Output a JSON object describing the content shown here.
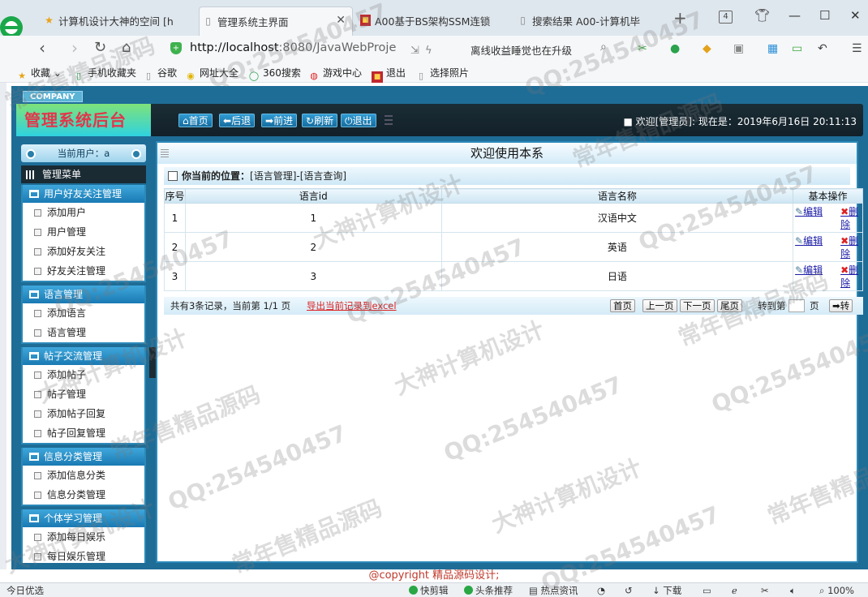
{
  "browser": {
    "tabs": [
      {
        "label": "计算机设计大神的空间 [h",
        "icon": "star-icon",
        "active": false
      },
      {
        "label": "管理系统主界面",
        "icon": "page-icon",
        "active": true
      },
      {
        "label": "A00基于BS架构SSM连锁",
        "icon": "red-favicon",
        "active": false
      },
      {
        "label": "搜索结果 A00-计算机毕",
        "icon": "page-icon",
        "active": false
      }
    ],
    "tab_count": "4",
    "url_host": "http://localhost",
    "url_rest": ":8080/JavaWebProje",
    "news": "离线收益睡觉也在升级",
    "bookmarks": [
      "收藏",
      "手机收藏夹",
      "谷歌",
      "网址大全",
      "360搜索",
      "游戏中心",
      "退出",
      "选择照片"
    ]
  },
  "app": {
    "company": "COMPANY",
    "brand": "管理系统后台",
    "toolbar": [
      "首页",
      "后退",
      "前进",
      "刷新",
      "退出"
    ],
    "welcome": "■ 欢迎[管理员]:   现在是：2019年6月16日 20:11:13",
    "current_user": "当前用户：a",
    "menu_title": "管理菜单",
    "groups": [
      {
        "title": "用户好友关注管理",
        "items": [
          "添加用户",
          "用户管理",
          "添加好友关注",
          "好友关注管理"
        ]
      },
      {
        "title": "语言管理",
        "items": [
          "添加语言",
          "语言管理"
        ]
      },
      {
        "title": "帖子交流管理",
        "items": [
          "添加帖子",
          "帖子管理",
          "添加帖子回复",
          "帖子回复管理"
        ]
      },
      {
        "title": "信息分类管理",
        "items": [
          "添加信息分类",
          "信息分类管理"
        ]
      },
      {
        "title": "个体学习管理",
        "items": [
          "添加每日娱乐",
          "每日娱乐管理"
        ]
      }
    ],
    "main_title": "欢迎使用本系",
    "breadcrumb_label": "你当前的位置：",
    "breadcrumb_path": "[语言管理]-[语言查询]",
    "table": {
      "headers": [
        "序号",
        "语言id",
        "语言名称",
        "基本操作"
      ],
      "rows": [
        {
          "no": "1",
          "id": "1",
          "name": "汉语中文"
        },
        {
          "no": "2",
          "id": "2",
          "name": "英语"
        },
        {
          "no": "3",
          "id": "3",
          "name": "日语"
        }
      ],
      "edit_label": "编辑",
      "delete_label": "删除"
    },
    "pagination": {
      "info": "共有3条记录，当前第 1/1 页",
      "export": "导出当前记录到excel",
      "first": "首页",
      "prev": "上一页",
      "next": "下一页",
      "last": "尾页",
      "jump_label": "转到第",
      "page_label": "页",
      "go": "➡转"
    },
    "copyright": "@copyright 精品源码设计;"
  },
  "statusbar": {
    "left": "今日优选",
    "items": [
      "快剪辑",
      "头条推荐",
      "热点资讯",
      "下载"
    ],
    "zoom": "100%"
  },
  "watermark": [
    "QQ:254540457",
    "常年售精品源码",
    "大神计算机设计"
  ]
}
